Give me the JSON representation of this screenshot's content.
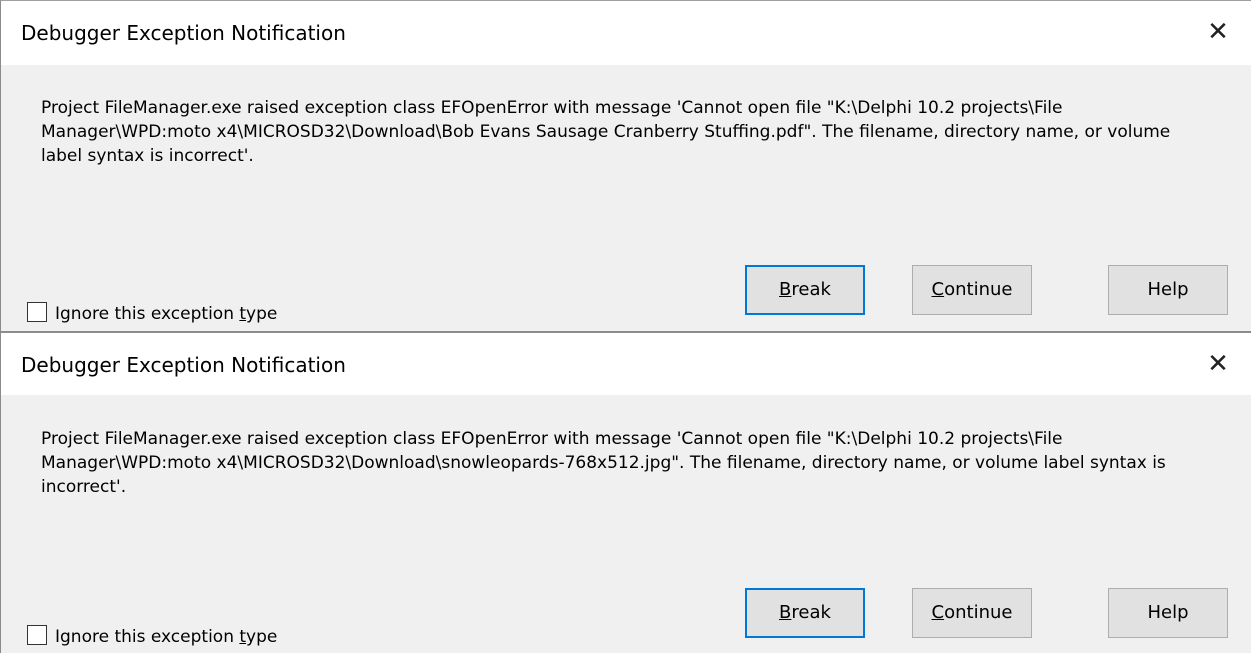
{
  "dialogs": [
    {
      "title": "Debugger Exception Notification",
      "close_icon": "close-icon",
      "message": "Project FileManager.exe raised exception class EFOpenError with message 'Cannot open file \"K:\\Delphi 10.2 projects\\File Manager\\WPD:moto x4\\MICROSD32\\Download\\Bob Evans Sausage Cranberry Stuffing.pdf\". The filename, directory name, or volume label syntax is incorrect'.",
      "checkbox": {
        "label_prefix": "Ignore this exception ",
        "label_accel": "t",
        "label_suffix": "ype",
        "checked": false
      },
      "buttons": {
        "break": {
          "accel": "B",
          "rest": "reak"
        },
        "continue": {
          "accel": "C",
          "rest": "ontinue"
        },
        "help": {
          "label": "Help"
        }
      }
    },
    {
      "title": "Debugger Exception Notification",
      "close_icon": "close-icon",
      "message": "Project FileManager.exe raised exception class EFOpenError with message 'Cannot open file \"K:\\Delphi 10.2 projects\\File Manager\\WPD:moto x4\\MICROSD32\\Download\\snowleopards-768x512.jpg\". The filename, directory name, or volume label syntax is incorrect'.",
      "checkbox": {
        "label_prefix": "Ignore this exception ",
        "label_accel": "t",
        "label_suffix": "ype",
        "checked": false
      },
      "buttons": {
        "break": {
          "accel": "B",
          "rest": "reak"
        },
        "continue": {
          "accel": "C",
          "rest": "ontinue"
        },
        "help": {
          "label": "Help"
        }
      }
    }
  ],
  "colors": {
    "dialog_bg": "#f0f0f0",
    "titlebar_bg": "#ffffff",
    "default_button_border": "#0078d7",
    "button_bg": "#e1e1e1"
  }
}
